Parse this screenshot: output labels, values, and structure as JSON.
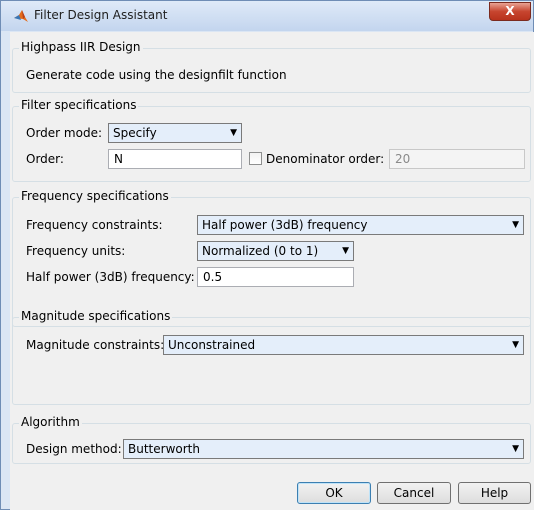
{
  "window": {
    "title": "Filter Design Assistant",
    "close_label": "X"
  },
  "design": {
    "legend": "Highpass IIR Design",
    "description": "Generate code using the designfilt function"
  },
  "filter_specs": {
    "legend": "Filter specifications",
    "order_mode_label": "Order mode:",
    "order_mode_value": "Specify",
    "order_label": "Order:",
    "order_value": "N",
    "denominator_label": "Denominator order:",
    "denominator_value": "20",
    "denominator_checked": false
  },
  "frequency_specs": {
    "legend": "Frequency specifications",
    "constraints_label": "Frequency constraints:",
    "constraints_value": "Half power (3dB) frequency",
    "units_label": "Frequency units:",
    "units_value": "Normalized (0 to 1)",
    "half_power_label": "Half power (3dB) frequency:",
    "half_power_value": "0.5"
  },
  "magnitude_specs": {
    "legend": "Magnitude specifications",
    "constraints_label": "Magnitude constraints:",
    "constraints_value": "Unconstrained"
  },
  "algorithm": {
    "legend": "Algorithm",
    "method_label": "Design method:",
    "method_value": "Butterworth"
  },
  "buttons": {
    "ok": "OK",
    "cancel": "Cancel",
    "help": "Help"
  },
  "colors": {
    "accent": "#3c7fb1",
    "close": "#c7452f"
  },
  "icons": {
    "app": "matlab-logo-icon",
    "dropdown": "chevron-down-icon"
  }
}
